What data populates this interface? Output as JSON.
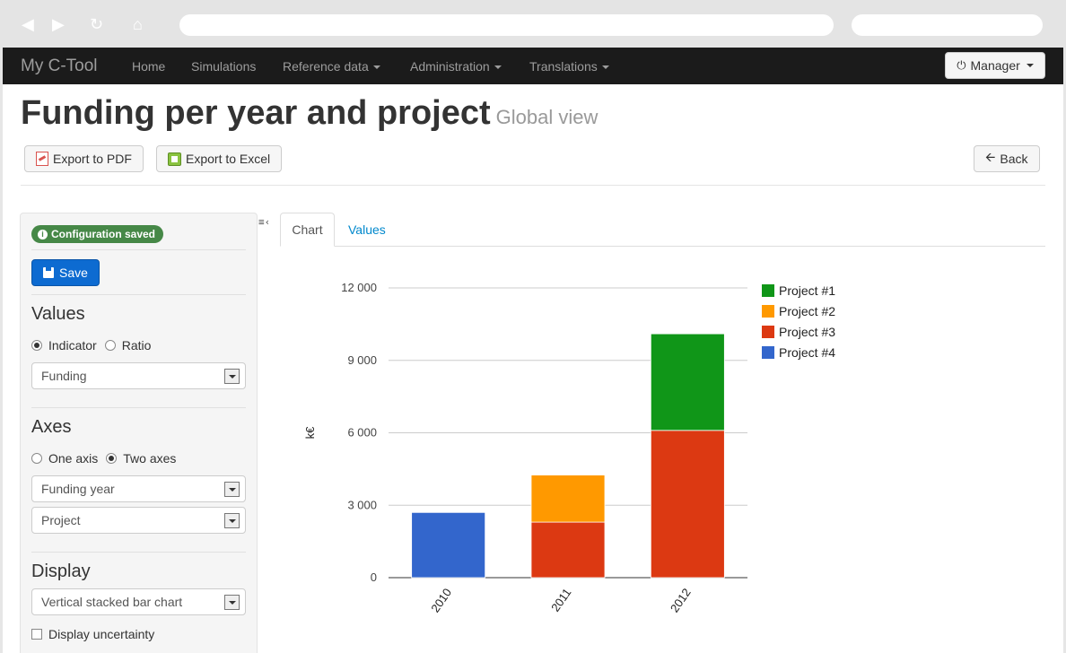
{
  "browser": {
    "back_icon": "back-arrow-icon",
    "forward_icon": "forward-arrow-icon",
    "reload_icon": "reload-icon",
    "home_icon": "home-icon"
  },
  "navbar": {
    "brand": "My C-Tool",
    "items": [
      {
        "label": "Home",
        "dropdown": false
      },
      {
        "label": "Simulations",
        "dropdown": false
      },
      {
        "label": "Reference data",
        "dropdown": true
      },
      {
        "label": "Administration",
        "dropdown": true
      },
      {
        "label": "Translations",
        "dropdown": true
      }
    ],
    "user_button": "Manager",
    "user_icon": "power-icon"
  },
  "header": {
    "title": "Funding per year and project",
    "subtitle": "Global view",
    "export_pdf": "Export to PDF",
    "export_excel": "Export to Excel",
    "back": "Back"
  },
  "sidebar": {
    "status_badge": "Configuration saved",
    "save_button": "Save",
    "values": {
      "title": "Values",
      "radio_indicator": "Indicator",
      "radio_ratio": "Ratio",
      "selected": "Indicator",
      "select_value": "Funding"
    },
    "axes": {
      "title": "Axes",
      "radio_one": "One axis",
      "radio_two": "Two axes",
      "selected": "Two axes",
      "select_first": "Funding year",
      "select_second": "Project"
    },
    "display": {
      "title": "Display",
      "select_value": "Vertical stacked bar chart",
      "checkbox_label": "Display uncertainty",
      "checkbox_checked": false
    }
  },
  "tabs": {
    "chart": "Chart",
    "values": "Values",
    "active": "Chart"
  },
  "chart_data": {
    "type": "bar",
    "stacked": true,
    "categories": [
      "2010",
      "2011",
      "2012"
    ],
    "series": [
      {
        "name": "Project #4",
        "color": "#3366cc",
        "values": [
          2700,
          0,
          0
        ]
      },
      {
        "name": "Project #3",
        "color": "#dc3912",
        "values": [
          0,
          2300,
          6100
        ]
      },
      {
        "name": "Project #2",
        "color": "#ff9900",
        "values": [
          0,
          1950,
          0
        ]
      },
      {
        "name": "Project #1",
        "color": "#109618",
        "values": [
          0,
          0,
          4000
        ]
      }
    ],
    "legend_order": [
      "Project #1",
      "Project #2",
      "Project #3",
      "Project #4"
    ],
    "ylabel": "k€",
    "ylim": [
      0,
      12000
    ],
    "yticks": [
      0,
      3000,
      6000,
      9000,
      12000
    ],
    "ytick_labels": [
      "0",
      "3 000",
      "6 000",
      "9 000",
      "12 000"
    ],
    "legend_position": "right",
    "grid": true
  }
}
